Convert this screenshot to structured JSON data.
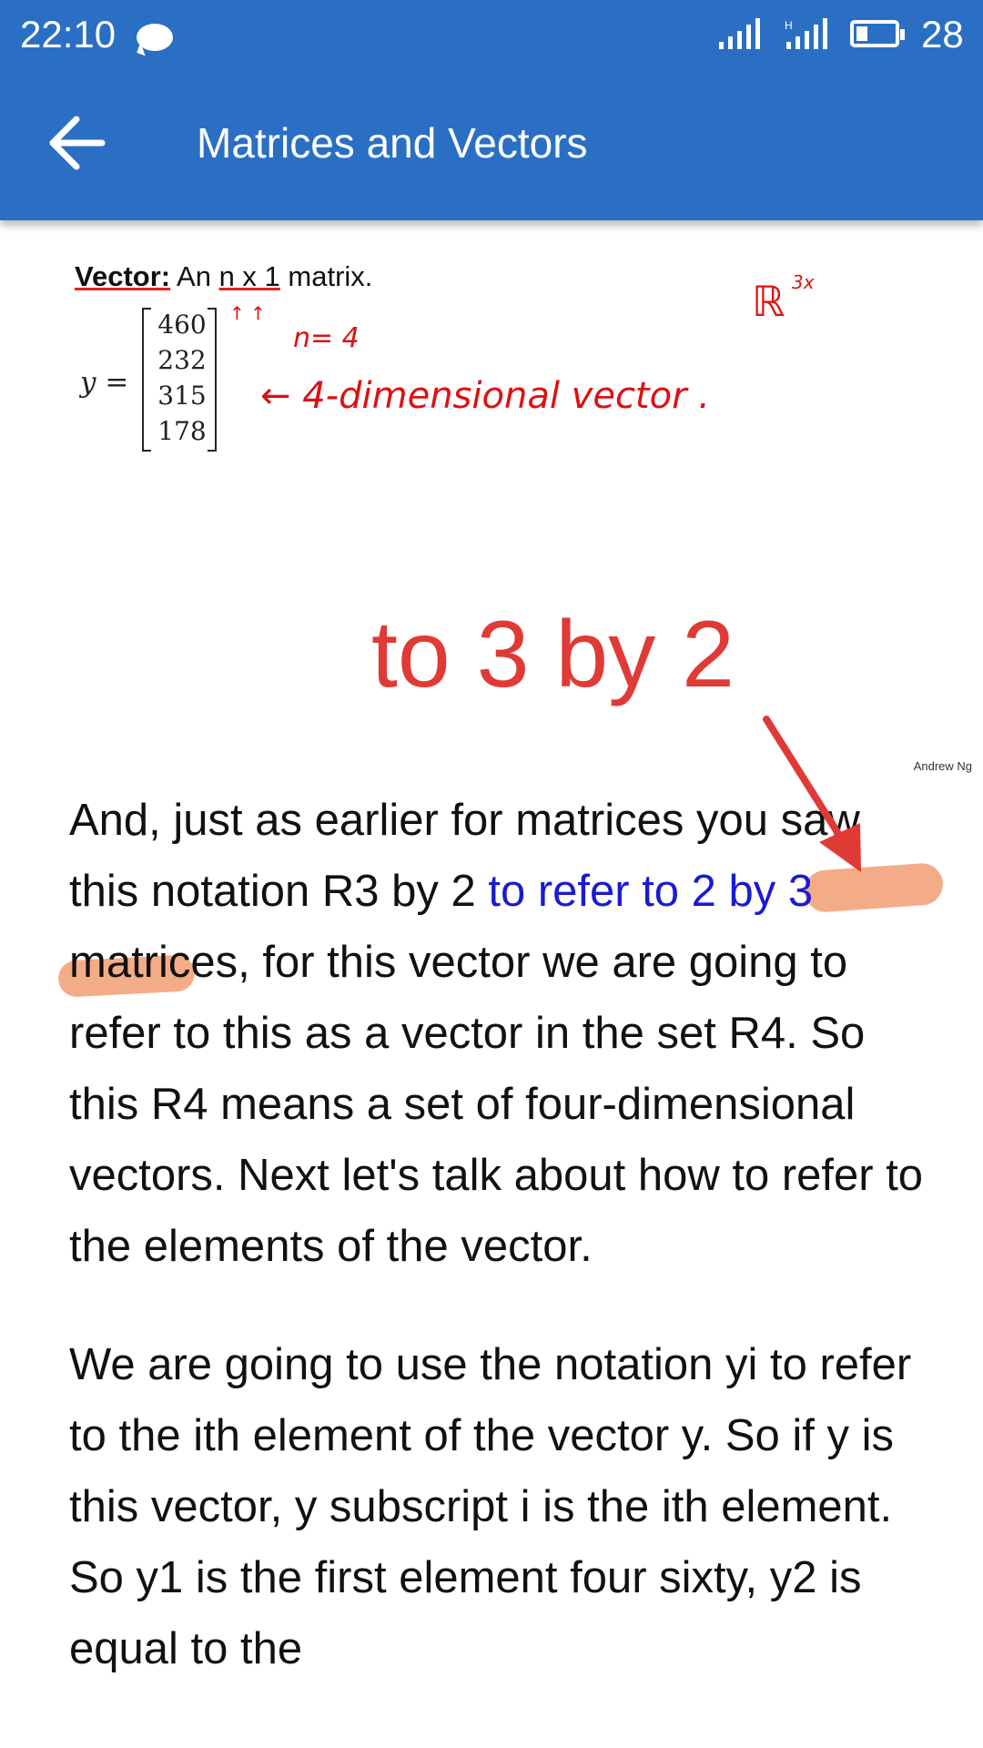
{
  "status_bar": {
    "time": "22:10",
    "battery_percent": "28",
    "icons": [
      "chat-bubble-icon",
      "signal-icon",
      "signal-h-icon",
      "battery-icon"
    ]
  },
  "app_bar": {
    "title": "Matrices and Vectors",
    "back_icon": "arrow-left-icon"
  },
  "slide": {
    "heading_bold": "Vector:",
    "heading_rest_1": "An",
    "heading_n1": "n x 1",
    "heading_rest_2": "matrix.",
    "math_label": "y =",
    "vector_entries": [
      "460",
      "232",
      "315",
      "178"
    ],
    "annotation_n": "n= 4",
    "annotation_dimension": "← 4-dimensional vector .",
    "annotation_space": "ℝ",
    "annotation_space_sup": "3x",
    "annotation_ticks": "↑  ↑",
    "author": "Andrew Ng"
  },
  "caption": "to 3 by 2",
  "article": {
    "p1_part1": "And, just as earlier for matrices you saw this notation R3 by 2 ",
    "p1_link": "to refer to 2 by 3",
    "p1_part2": " matrices, for this vector we are going to refer to this as a vector in the set R4. So this R4 means a set of four-dimensional vectors. Next let's talk about how to refer to the elements of the vector.",
    "p2": "We are going to use the notation yi to refer to the ith element of the vector y. So if y is this vector, y subscript i is the ith element. So y1 is the first element four sixty, y2 is equal to the"
  },
  "colors": {
    "app_bar": "#2a6fc4",
    "caption": "#e03a36",
    "link": "#1a1ad4",
    "highlight": "#f08c5a",
    "annotation": "#d11111"
  }
}
